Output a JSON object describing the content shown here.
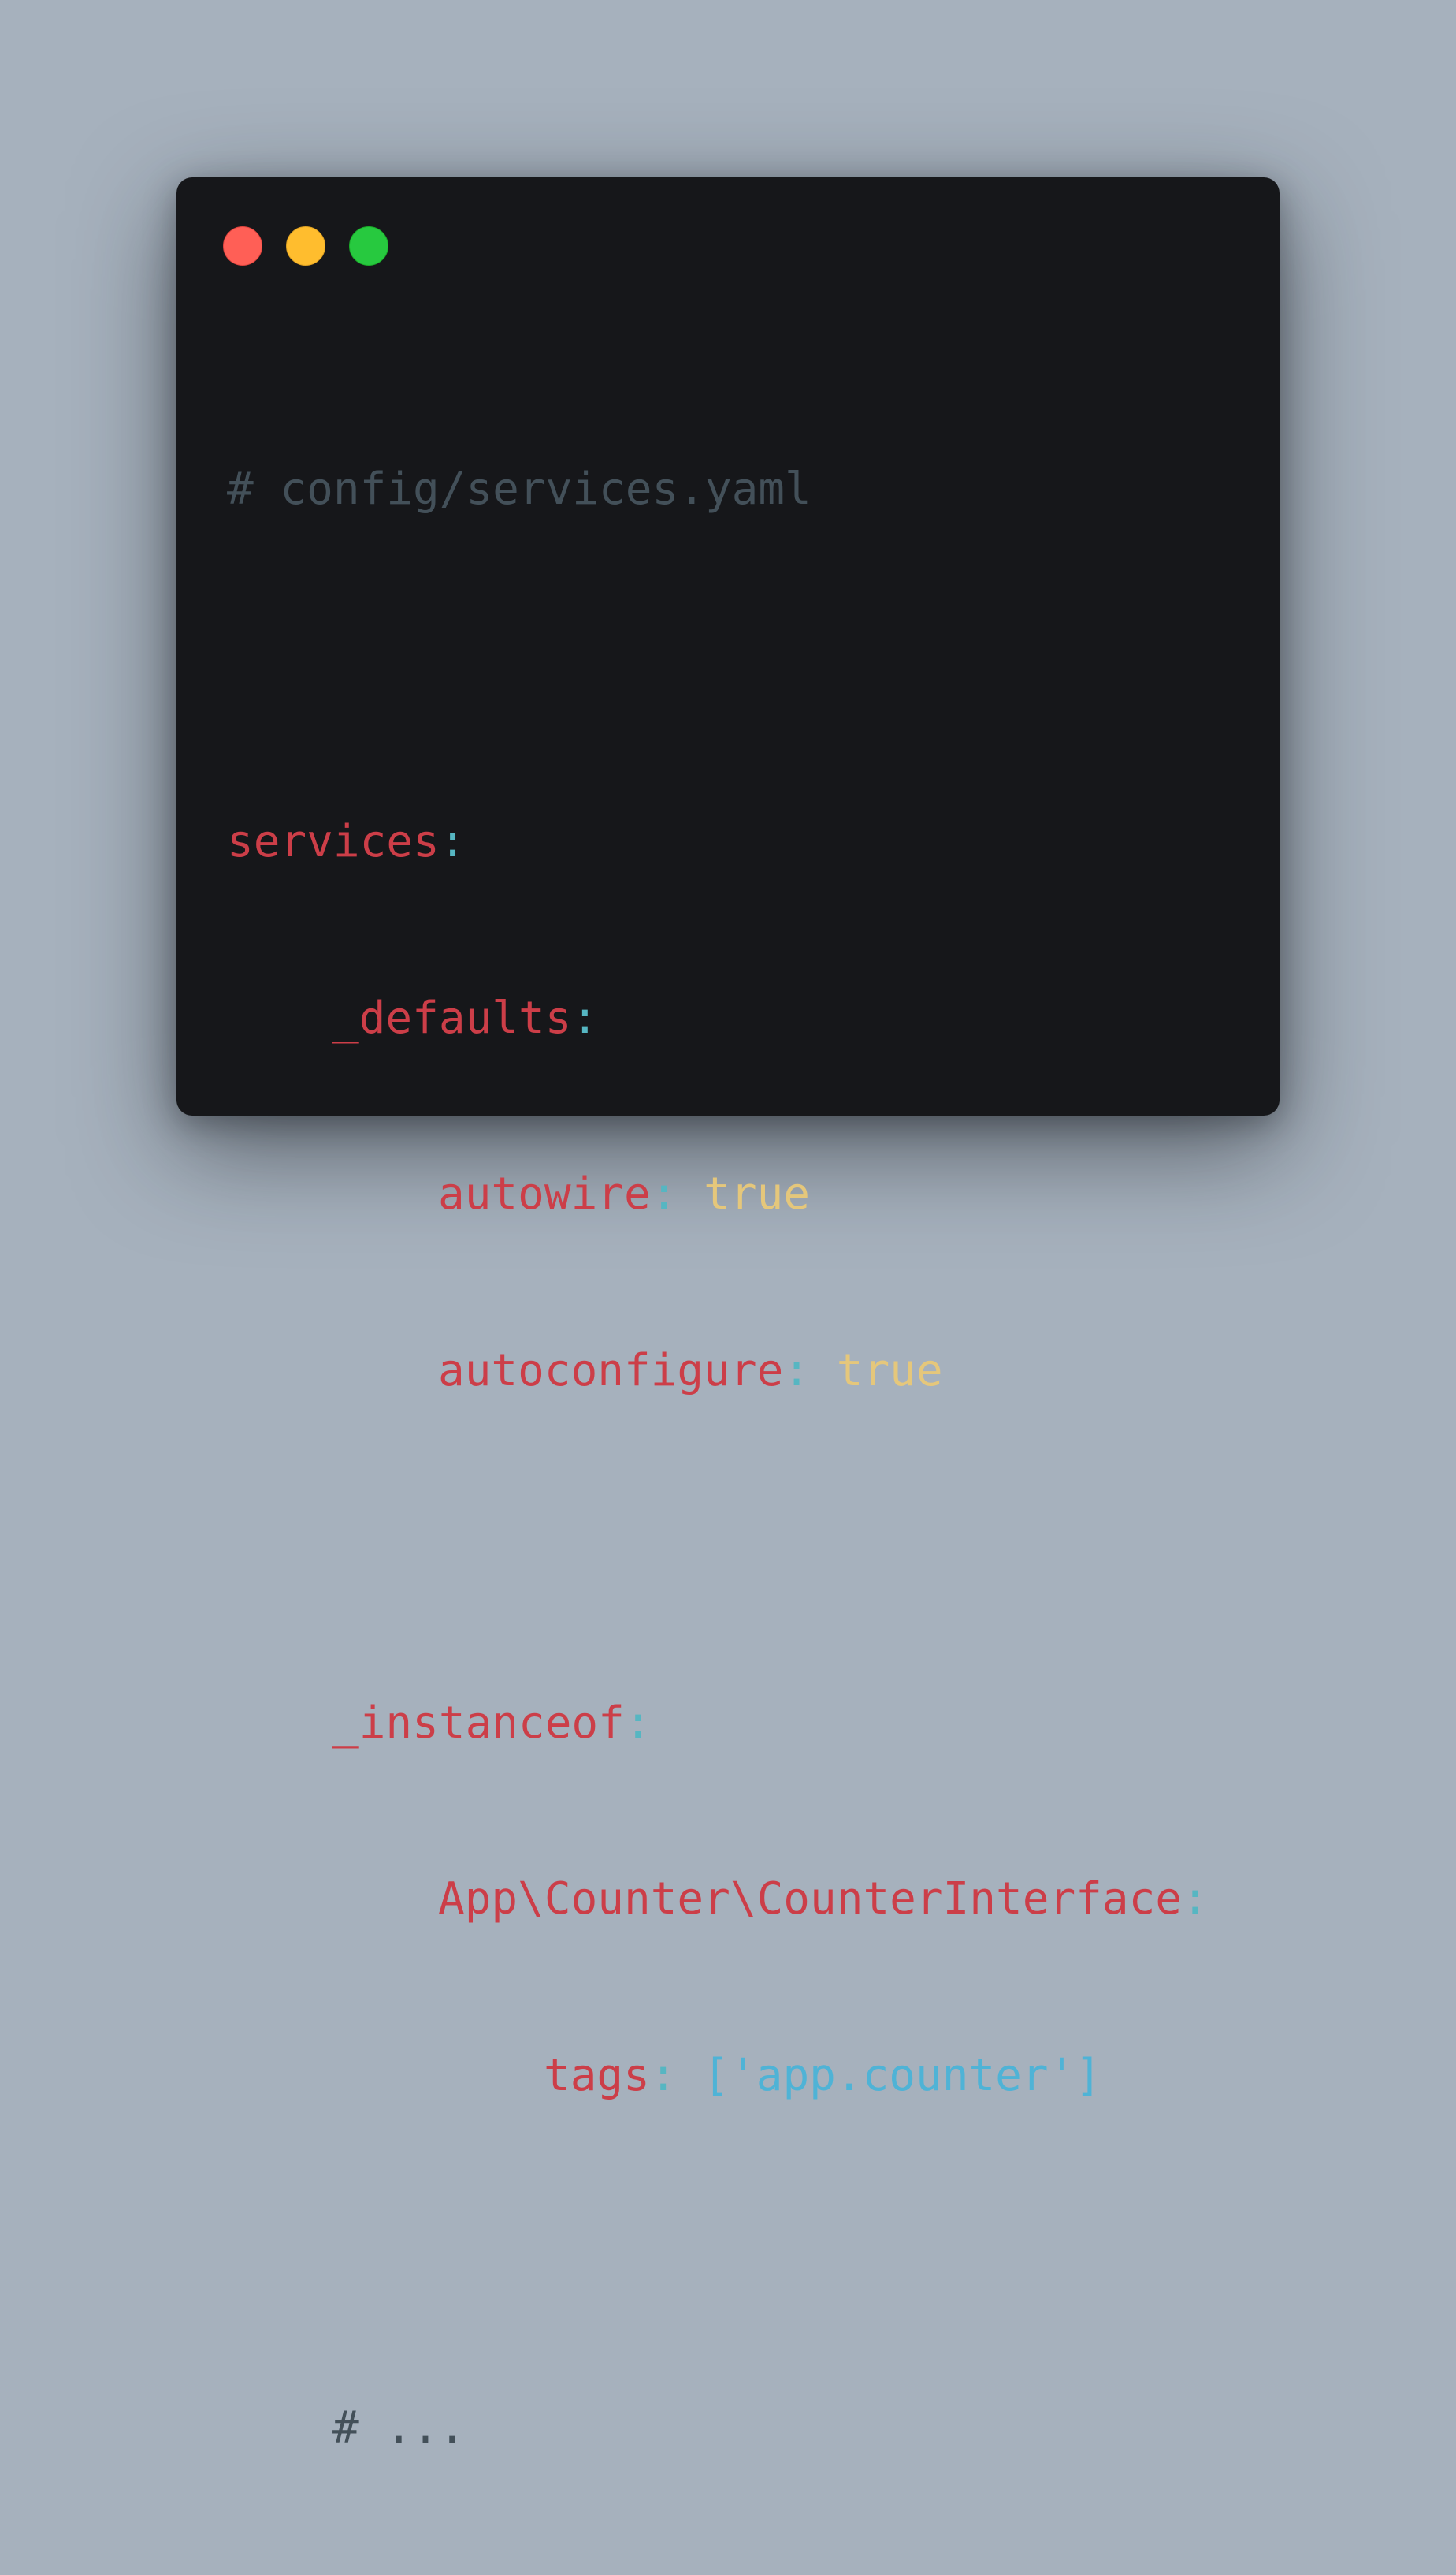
{
  "window": {
    "controls": {
      "close_color": "#ff5f56",
      "minimize_color": "#ffbd2e",
      "maximize_color": "#27c93f"
    }
  },
  "colors": {
    "background": "#a6b1bd",
    "editor": "#16171a",
    "comment": "#435059",
    "key": "#cc3e48",
    "punctuation": "#56b6c2",
    "boolean": "#e5c77b",
    "string": "#4fb3d6"
  },
  "code": {
    "header_comment": "# config/services.yaml",
    "services_key": "services",
    "defaults_key": "_defaults",
    "autowire_key": "autowire",
    "autowire_value": "true",
    "autoconfigure_key": "autoconfigure",
    "autoconfigure_value": "true",
    "instanceof_key": "_instanceof",
    "interface_key": "App\\Counter\\CounterInterface",
    "tags_key": "tags",
    "tags_open": "[",
    "tags_value": "'app.counter'",
    "tags_close": "]",
    "colon": ":",
    "trailing_comment": "# ..."
  }
}
